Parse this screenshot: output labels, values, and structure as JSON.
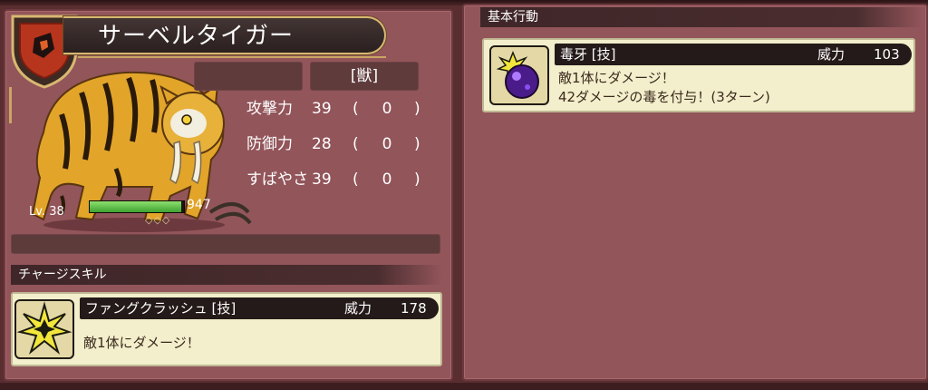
{
  "monster": {
    "name": "サーベルタイガー",
    "type": "[獣]",
    "level": "Lv. 38",
    "hp": 947,
    "hp_fill_fraction": 0.97,
    "diamonds": "◇◇◇",
    "stats": [
      {
        "label": "攻撃力",
        "value": "39",
        "modifier": "0"
      },
      {
        "label": "防御力",
        "value": "28",
        "modifier": "0"
      },
      {
        "label": "すばやさ",
        "value": "39",
        "modifier": "0"
      }
    ],
    "paren_open": "(",
    "paren_close": ")"
  },
  "charge_skill": {
    "header": "チャージスキル",
    "name": "ファングクラッシュ [技]",
    "power_label": "威力",
    "power": "178",
    "description": "敵1体にダメージ！",
    "icon": "impact-burst-icon"
  },
  "basic_action": {
    "header": "基本行動",
    "name": "毒牙 [技]",
    "power_label": "威力",
    "power": "103",
    "description_line1": "敵1体にダメージ！",
    "description_line2": "42ダメージの毒を付与！(3ターン)",
    "icon": "poison-orb-icon"
  },
  "colors": {
    "panel": "#92555a",
    "hp_bar": "#4fbf3a",
    "card_bg": "#f3eecb",
    "gold_frame": "#d8b871"
  }
}
